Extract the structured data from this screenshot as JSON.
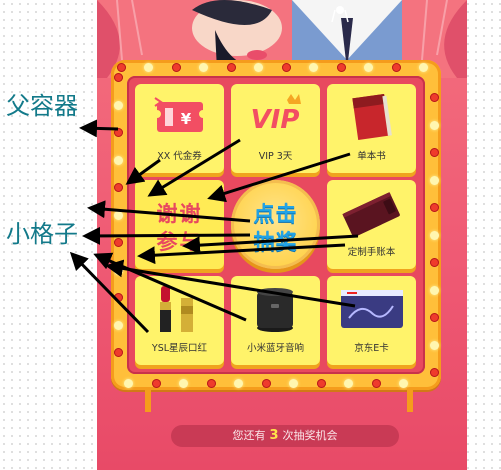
{
  "annotations": {
    "parent_container": "父容器",
    "grid_cell": "小格子"
  },
  "prizes": [
    {
      "label": "XX 代金券",
      "icon": "voucher-icon"
    },
    {
      "label": "VIP 3天",
      "icon": "vip-icon"
    },
    {
      "label": "单本书",
      "icon": "book-icon"
    },
    {
      "label": "",
      "icon": "thank-you-icon"
    },
    {
      "label": "定制手账本",
      "icon": "notebook-icon"
    },
    {
      "label": "YSL星辰口红",
      "icon": "lipstick-icon"
    },
    {
      "label": "小米蓝牙音响",
      "icon": "speaker-icon"
    },
    {
      "label": "京东E卡",
      "icon": "jd-card-icon"
    }
  ],
  "thanks_cell": {
    "line1": "谢谢",
    "line2": "参与"
  },
  "draw_button": {
    "line1": "点击",
    "line2": "抽奖"
  },
  "chance_bar": {
    "prefix": "您还有",
    "count": "3",
    "suffix": "次抽奖机会"
  },
  "colors": {
    "page_bg": "#ef5a74",
    "frame": "#ffbf3a",
    "cell": "#fff36a",
    "draw_text": "#22a3e6",
    "annotation": "#137a8a"
  }
}
